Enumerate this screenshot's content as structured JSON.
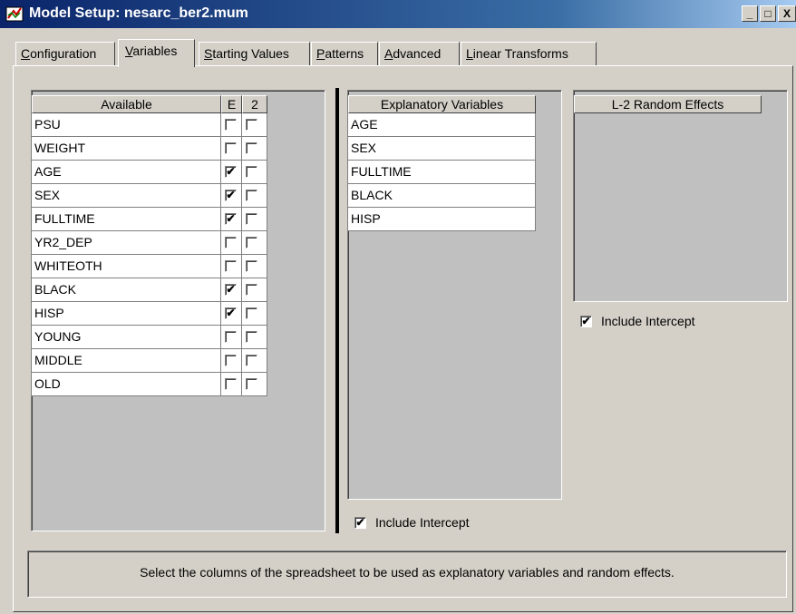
{
  "window": {
    "title": "Model Setup: nesarc_ber2.mum",
    "minimize": "_",
    "maximize": "□",
    "close": "X"
  },
  "tabs": [
    {
      "prefix": "",
      "underline": "C",
      "rest": "onfiguration",
      "active": false
    },
    {
      "prefix": "",
      "underline": "V",
      "rest": "ariables",
      "active": true
    },
    {
      "prefix": "",
      "underline": "S",
      "rest": "tarting Values",
      "active": false
    },
    {
      "prefix": "",
      "underline": "P",
      "rest": "atterns",
      "active": false
    },
    {
      "prefix": "",
      "underline": "A",
      "rest": "dvanced",
      "active": false
    },
    {
      "prefix": "",
      "underline": "L",
      "rest": "inear Transforms",
      "active": false
    }
  ],
  "available": {
    "header": "Available",
    "col_e": "E",
    "col_2": "2",
    "rows": [
      {
        "name": "PSU",
        "e": false,
        "l2": false
      },
      {
        "name": "WEIGHT",
        "e": false,
        "l2": false
      },
      {
        "name": "AGE",
        "e": true,
        "l2": false
      },
      {
        "name": "SEX",
        "e": true,
        "l2": false
      },
      {
        "name": "FULLTIME",
        "e": true,
        "l2": false
      },
      {
        "name": "YR2_DEP",
        "e": false,
        "l2": false
      },
      {
        "name": "WHITEOTH",
        "e": false,
        "l2": false
      },
      {
        "name": "BLACK",
        "e": true,
        "l2": false
      },
      {
        "name": "HISP",
        "e": true,
        "l2": false
      },
      {
        "name": "YOUNG",
        "e": false,
        "l2": false
      },
      {
        "name": "MIDDLE",
        "e": false,
        "l2": false
      },
      {
        "name": "OLD",
        "e": false,
        "l2": false
      }
    ]
  },
  "explanatory": {
    "header": "Explanatory Variables",
    "rows": [
      "AGE",
      "SEX",
      "FULLTIME",
      "BLACK",
      "HISP"
    ],
    "include_intercept_label": "Include Intercept",
    "include_intercept_checked": true
  },
  "random_effects": {
    "header": "L-2 Random Effects",
    "rows": [],
    "include_intercept_label": "Include Intercept",
    "include_intercept_checked": true
  },
  "status_text": "Select the columns of the spreadsheet to be used as explanatory variables and random effects.",
  "check_glyph": "✔"
}
